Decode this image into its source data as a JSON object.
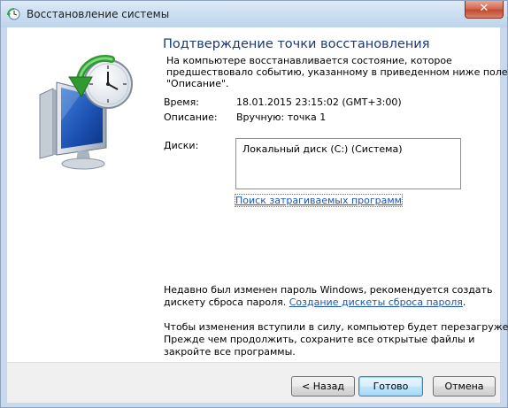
{
  "window": {
    "title": "Восстановление системы",
    "close_symbol": "✕"
  },
  "content": {
    "heading": "Подтверждение точки восстановления",
    "intro_lines": [
      "На компьютере восстанавливается состояние, которое",
      "предшествовало событию, указанному в приведенном ниже поле",
      "\"Описание\"."
    ],
    "time_label": "Время:",
    "time_value": "18.01.2015 23:15:02 (GMT+3:00)",
    "description_label": "Описание:",
    "description_value": "Вручную: точка 1",
    "disks_label": "Диски:",
    "disks": [
      "Локальный диск (C:) (Система)"
    ],
    "scan_link": "Поиск затрагиваемых программ",
    "password_line1": "Недавно был изменен пароль Windows, рекомендуется создать",
    "password_line2_prefix": "дискету сброса пароля. ",
    "password_link": "Создание дискеты сброса пароля",
    "password_line2_suffix": ".",
    "restart_lines": [
      "Чтобы изменения вступили в силу, компьютер будет перезагружен.",
      "Прежде чем продолжить, сохраните все открытые файлы и",
      "закройте все программы."
    ]
  },
  "buttons": {
    "back": "< Назад",
    "finish": "Готово",
    "cancel": "Отмена"
  },
  "icons": {
    "title": "system-restore-icon",
    "art": "system-restore-monitor-clock-icon"
  }
}
